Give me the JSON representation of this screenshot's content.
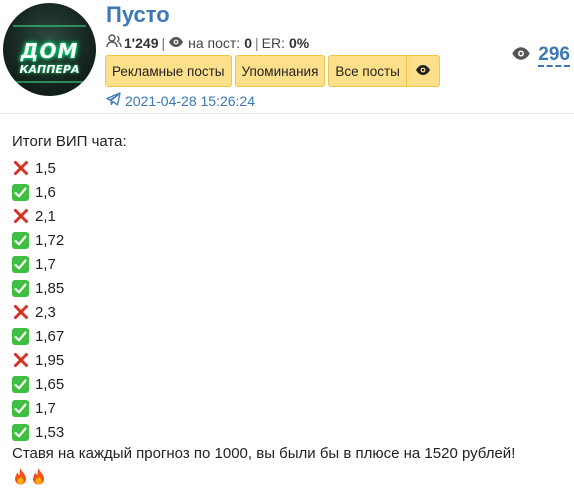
{
  "channel": {
    "title": "Пусто",
    "avatar_text": "ДОМ",
    "avatar_subtext": "КАППЕРА",
    "subscribers": "1'249",
    "per_post_label": "на пост:",
    "per_post_value": "0",
    "er_label": "ER:",
    "er_value": "0%"
  },
  "buttons": {
    "ads": "Рекламные посты",
    "mentions": "Упоминания",
    "all_posts": "Все посты"
  },
  "post": {
    "timestamp": "2021-04-28 15:26:24",
    "views": "296",
    "heading": "Итоги ВИП чата:",
    "results": [
      {
        "outcome": "loss",
        "odds": "1,5"
      },
      {
        "outcome": "win",
        "odds": "1,6"
      },
      {
        "outcome": "loss",
        "odds": "2,1"
      },
      {
        "outcome": "win",
        "odds": "1,72"
      },
      {
        "outcome": "win",
        "odds": "1,7"
      },
      {
        "outcome": "win",
        "odds": "1,85"
      },
      {
        "outcome": "loss",
        "odds": "2,3"
      },
      {
        "outcome": "win",
        "odds": "1,67"
      },
      {
        "outcome": "loss",
        "odds": "1,95"
      },
      {
        "outcome": "win",
        "odds": "1,65"
      },
      {
        "outcome": "win",
        "odds": "1,7"
      },
      {
        "outcome": "win",
        "odds": "1,53"
      }
    ],
    "summary": "Ставя на каждый прогноз по 1000, вы были бы в плюсе на 1520 рублей!",
    "emoji": [
      "fire-icon",
      "fire-icon"
    ]
  },
  "colors": {
    "link": "#3d77b4",
    "button_bg": "#ffe08a",
    "win": "#3fbf3f",
    "loss": "#d93025"
  }
}
